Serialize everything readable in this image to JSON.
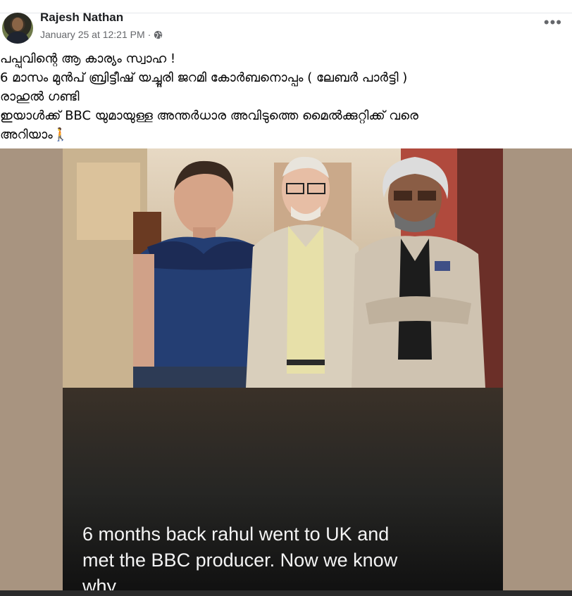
{
  "post": {
    "author": "Rajesh Nathan",
    "timestamp": "January 25 at 12:21 PM",
    "separator": "·",
    "audience_icon": "globe-icon",
    "more_label": "•••",
    "text_lines": [
      "പപ്പുവിന്റെ ആ കാര്യം സ്വാഹ !",
      "  6 മാസം മുൻപ് ബ്രിട്ടീഷ് യച്ചൂരി ജറമി കോർബനൊപ്പം ( ലേബർ പാർട്ടി )",
      "രാഹുൽ ഗണ്ടി",
      "ഇയാൾക്ക് BBC യുമായുള്ള അന്തർധാര അവിടുത്തെ മൈൽക്കുറ്റിക്ക് വരെ",
      "അറിയാം🚶"
    ]
  },
  "image": {
    "caption_lines": [
      "6 months back rahul went to UK and",
      "met the BBC producer. Now we know",
      "why"
    ]
  },
  "colors": {
    "name": "#1c1e21",
    "meta": "#65676b",
    "media_bg": "#a89480",
    "caption": "#f4f4f4"
  }
}
